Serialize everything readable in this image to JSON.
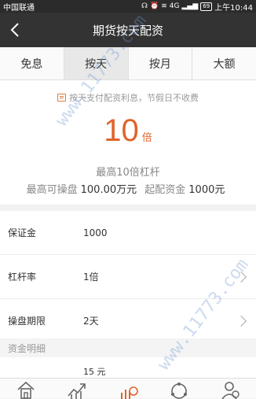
{
  "status_bar": {
    "carrier": "中国联通",
    "signal": "4G",
    "battery": "69",
    "time": "上午10:44"
  },
  "nav": {
    "title": "期货按天配资",
    "back_icon": "chevron-left-icon"
  },
  "tabs": [
    {
      "label": "免息",
      "active": false
    },
    {
      "label": "按天",
      "active": true
    },
    {
      "label": "按月",
      "active": false
    },
    {
      "label": "大额",
      "active": false
    }
  ],
  "info": {
    "notice": "按天支付配资利息，节假日不收费",
    "multiple_value": "10",
    "multiple_unit": "倍",
    "max_leverage": "最高10倍杠杆",
    "max_trade_label": "最高可操盘",
    "max_trade_value": "100.00万元",
    "min_capital_label": "起配资金",
    "min_capital_value": "1000元"
  },
  "form": {
    "rows": [
      {
        "label": "保证金",
        "value": "1000"
      },
      {
        "label": "杠杆率",
        "value": "1倍"
      },
      {
        "label": "操盘期限",
        "value": "2天"
      }
    ],
    "section_title": "资金明细",
    "detail_value": "15 元"
  },
  "tabbar": {
    "icons": [
      "home-icon",
      "market-chart-icon",
      "trade-icon",
      "discover-icon",
      "account-icon"
    ]
  },
  "colors": {
    "accent": "#e0632c",
    "nav_bg": "#333333",
    "status_bg": "#2b2b2b"
  },
  "watermark": "www.11773.com"
}
